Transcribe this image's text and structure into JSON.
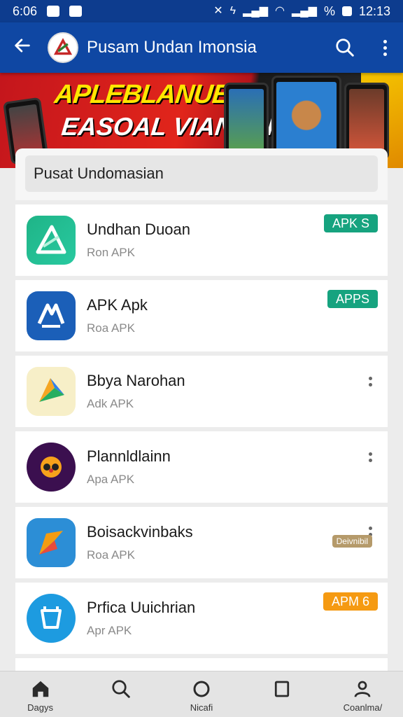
{
  "status_bar": {
    "time_left": "6:06",
    "time_right": "12:13",
    "battery_text": "%"
  },
  "app_bar": {
    "title": "Pusam Undan Imonsia",
    "back_icon": "arrow-left-icon",
    "search_icon": "search-icon",
    "more_icon": "more-vertical-icon"
  },
  "banner": {
    "line1": "APLEBLANUEN",
    "line2": "EASOAL VIANALIA!"
  },
  "search": {
    "text": "Pusat Undomasian"
  },
  "apps": [
    {
      "name": "Undhan Duoan",
      "sub": "Ron APK",
      "badge": "APK S",
      "badge_color": "#16a37f"
    },
    {
      "name": "APK Apk",
      "sub": "Roa APK",
      "badge": "APPS",
      "badge_color": "#16a37f"
    },
    {
      "name": "Bbya Narohan",
      "sub": "Adk APK",
      "badge": "",
      "badge_color": ""
    },
    {
      "name": "Plannldlainn",
      "sub": "Apa APK",
      "badge": "",
      "badge_color": ""
    },
    {
      "name": "Boisackvinbaks",
      "sub": "Roa APK",
      "badge": "Deivnibil",
      "badge_color": "#b59a6a"
    },
    {
      "name": "Prfica Uuichrian",
      "sub": "Apr APK",
      "badge": "APM 6",
      "badge_color": "#f59a12"
    }
  ],
  "bottom_nav": [
    {
      "label": "Dagys",
      "icon": "home-icon"
    },
    {
      "label": "",
      "icon": "search-icon"
    },
    {
      "label": "Nicafi",
      "icon": "circle-icon"
    },
    {
      "label": "",
      "icon": "document-icon"
    },
    {
      "label": "Coanlma/",
      "icon": "person-icon"
    }
  ]
}
